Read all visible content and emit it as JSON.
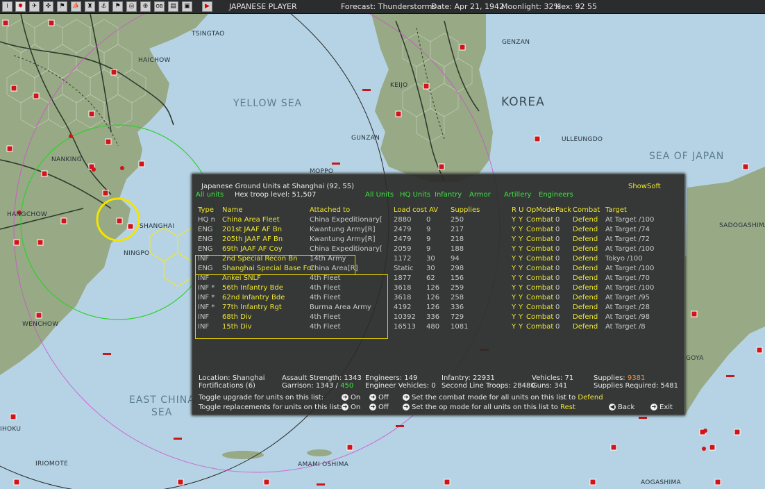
{
  "topbar": {
    "buttons": [
      "i",
      "✹",
      "✈",
      "✜",
      "⚑",
      "⛵",
      "♜",
      "⚓",
      "⚑",
      "◎",
      "⊕",
      "OB",
      "▤",
      "▣",
      "▶"
    ],
    "player": "JAPANESE PLAYER",
    "forecast": "Forecast: Thunderstorms",
    "date": "Date: Apr 21, 1942",
    "moonlight": "Moonlight: 32%",
    "hex": "Hex: 92 55"
  },
  "map": {
    "labels": {
      "tsingtao": "TSINGTAO",
      "haichow": "HAICHOW",
      "nanking": "NANKING",
      "hangchow": "HANGCHOW",
      "shanghai": "SHANGHAI",
      "ningpo": "NINGPO",
      "wenchow": "WENCHOW",
      "genzan": "GENZAN",
      "keijo": "KEIJO",
      "gunzan": "GUNZAN",
      "ulleungdo": "ULLEUNGDO",
      "moppo": "MOPPO",
      "sadogashima": "SADOGASHIMA",
      "iriomote": "IRIOMOTE",
      "amami": "AMAMI OSHIMA",
      "aogashima": "AOGASHIMA",
      "ihoku": "IHOKU",
      "goya": "GOYA"
    },
    "seas": {
      "yellow_sea": "YELLOW SEA",
      "sea_of_japan": "SEA OF JAPAN",
      "east_china_1": "EAST CHINA",
      "east_china_2": "SEA"
    },
    "countries": {
      "korea": "KOREA"
    }
  },
  "panel": {
    "title": "Japanese Ground Units at Shanghai  (92, 55)",
    "troop_level": "Hex troop level: 51,507",
    "show_soft": "ShowSoft",
    "filters": {
      "all_units_left": "All units",
      "all_units": "All Units",
      "hq_units": "HQ Units",
      "infantry": "Infantry",
      "armor": "Armor",
      "artillery": "Artillery",
      "engineers": "Engineers"
    },
    "headers": {
      "type": "Type",
      "name": "Name",
      "attached": "Attached to",
      "load": "Load cost AV",
      "supplies": "Supplies",
      "ru": "R U",
      "opmode": "OpMode",
      "pack": "Pack",
      "combat": "Combat",
      "target": "Target"
    },
    "units": [
      {
        "type": "HQ  n",
        "name": "China Area Fleet",
        "attached": "China Expeditionary[",
        "load": "2880",
        "av": "0",
        "supplies": "250",
        "r": "Y",
        "u": "Y",
        "opmode": "Combat",
        "pack": "0",
        "combat": "Defend",
        "target": "At Target /100"
      },
      {
        "type": "ENG",
        "name": "201st JAAF AF Bn",
        "attached": "Kwantung Army[R]",
        "load": "2479",
        "av": "9",
        "supplies": "217",
        "r": "Y",
        "u": "Y",
        "opmode": "Combat",
        "pack": "0",
        "combat": "Defend",
        "target": "At Target /74"
      },
      {
        "type": "ENG",
        "name": "205th JAAF AF Bn",
        "attached": "Kwantung Army[R]",
        "load": "2479",
        "av": "9",
        "supplies": "218",
        "r": "Y",
        "u": "Y",
        "opmode": "Combat",
        "pack": "0",
        "combat": "Defend",
        "target": "At Target /72"
      },
      {
        "type": "ENG",
        "name": "69th JAAF AF Coy",
        "attached": "China Expeditionary[",
        "load": "2059",
        "av": "9",
        "supplies": "188",
        "r": "Y",
        "u": "Y",
        "opmode": "Combat",
        "pack": "0",
        "combat": "Defend",
        "target": "At Target /100"
      },
      {
        "type": "INF",
        "name": "2nd Special Recon Bn",
        "attached": "14th Army",
        "load": "1172",
        "av": "30",
        "supplies": "94",
        "r": "Y",
        "u": "Y",
        "opmode": "Combat",
        "pack": "0",
        "combat": "Defend",
        "target": "Tokyo /100"
      },
      {
        "type": "ENG",
        "name": "Shanghai Special Base For",
        "attached": "China Area[R]",
        "load": "Static",
        "av": "30",
        "supplies": "298",
        "r": "Y",
        "u": "Y",
        "opmode": "Combat",
        "pack": "0",
        "combat": "Defend",
        "target": "At Target /100"
      },
      {
        "type": "INF",
        "name": "Ankei SNLF",
        "attached": "4th Fleet",
        "load": "1877",
        "av": "62",
        "supplies": "156",
        "r": "Y",
        "u": "Y",
        "opmode": "Combat",
        "pack": "0",
        "combat": "Defend",
        "target": "At Target /70"
      },
      {
        "type": "INF *",
        "name": "56th Infantry Bde",
        "attached": "4th Fleet",
        "load": "3618",
        "av": "126",
        "supplies": "259",
        "r": "Y",
        "u": "Y",
        "opmode": "Combat",
        "pack": "0",
        "combat": "Defend",
        "target": "At Target /100"
      },
      {
        "type": "INF *",
        "name": "62nd Infantry Bde",
        "attached": "4th Fleet",
        "load": "3618",
        "av": "126",
        "supplies": "258",
        "r": "Y",
        "u": "Y",
        "opmode": "Combat",
        "pack": "0",
        "combat": "Defend",
        "target": "At Target /95"
      },
      {
        "type": "INF *",
        "name": "77th Infantry Rgt",
        "attached": "Burma Area Army",
        "load": "4192",
        "av": "126",
        "supplies": "336",
        "r": "Y",
        "u": "Y",
        "opmode": "Combat",
        "pack": "0",
        "combat": "Defend",
        "target": "At Target /28"
      },
      {
        "type": "INF",
        "name": "68th Div",
        "attached": "4th Fleet",
        "load": "10392",
        "av": "336",
        "supplies": "729",
        "r": "Y",
        "u": "Y",
        "opmode": "Combat",
        "pack": "0",
        "combat": "Defend",
        "target": "At Target /98"
      },
      {
        "type": "INF",
        "name": "15th Div",
        "attached": "4th Fleet",
        "load": "16513",
        "av": "480",
        "supplies": "1081",
        "r": "Y",
        "u": "Y",
        "opmode": "Combat",
        "pack": "0",
        "combat": "Defend",
        "target": "At Target /8"
      }
    ],
    "summary": {
      "location": "Location: Shanghai",
      "fortifications": "Fortifications (6)",
      "assault": "Assault Strength: 1343",
      "garrison_label": "Garrison: 1343 /",
      "garrison_value": "450",
      "engineers": "Engineers: 149",
      "eng_vehicles": "Engineer Vehicles: 0",
      "infantry": "Infantry: 22931",
      "second_line": "Second Line Troops: 28480",
      "vehicles": "Vehicles: 71",
      "guns": "Guns: 341",
      "supplies_label": "Supplies:",
      "supplies_value": "9381",
      "supplies_required": "Supplies Required: 5481"
    },
    "controls": {
      "toggle_upgrade": "Toggle upgrade for units on this list:",
      "toggle_replacements": "Toggle replacements for units on this list:",
      "on": "On",
      "off": "Off",
      "set_combat": "Set the combat mode for all units on this list to",
      "combat_value": "Defend",
      "set_op": "Set the op mode for all units on this list to",
      "op_value": "Rest",
      "back": "Back",
      "exit": "Exit"
    }
  },
  "colors": {
    "sea": "#b5d3e4",
    "land": "#96a882",
    "panel_bg": "#2a2a28",
    "highlight_yellow": "#f0e630",
    "filter_green": "#3fe23f",
    "base_red": "#d0141a"
  }
}
